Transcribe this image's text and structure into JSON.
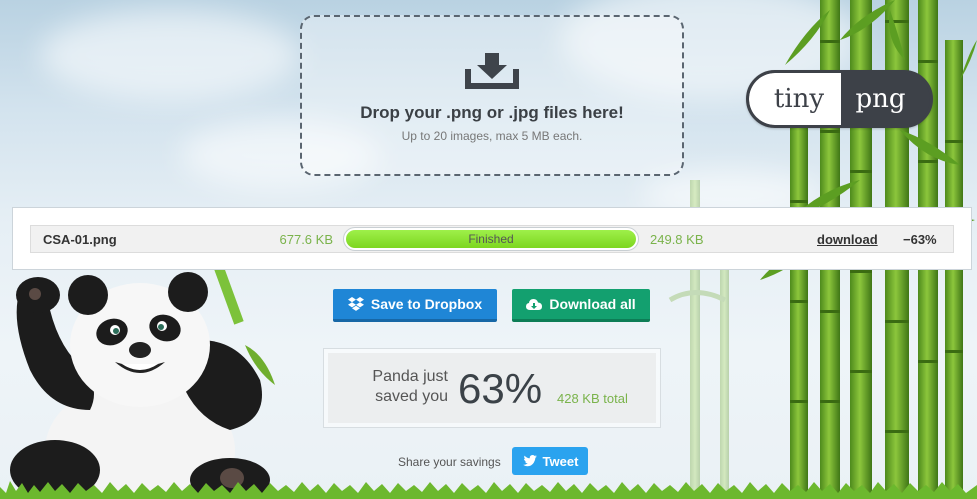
{
  "dropzone": {
    "title": "Drop your .png or .jpg files here!",
    "subtitle": "Up to 20 images, max 5 MB each.",
    "icon": "download-tray-icon"
  },
  "logo": {
    "left": "tiny",
    "right": "png"
  },
  "file_row": {
    "filename": "CSA-01.png",
    "original_size": "677.6 KB",
    "status": "Finished",
    "progress": 1.0,
    "new_size": "249.8 KB",
    "download_label": "download",
    "reduction": "−63%"
  },
  "buttons": {
    "dropbox": "Save to Dropbox",
    "download_all": "Download all"
  },
  "savings": {
    "label": "Panda just saved you",
    "percent": "63%",
    "total": "428 KB total"
  },
  "share": {
    "label": "Share your savings",
    "tweet": "Tweet"
  },
  "colors": {
    "dropbox": "#1f86d6",
    "download_all": "#13a06f",
    "tweet": "#2aa3ef",
    "progress": "#86de2a",
    "size_text": "#7ab34b"
  }
}
